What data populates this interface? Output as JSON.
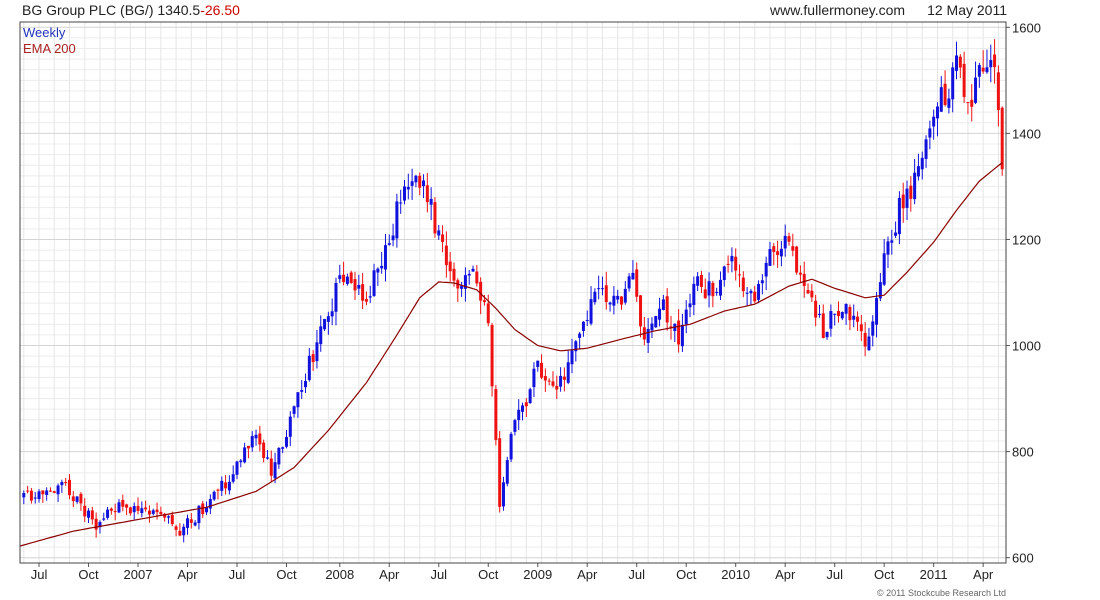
{
  "header": {
    "title": "BG Group PLC (BG/)",
    "last_price": "1340.5",
    "change": "-26.50",
    "site": "www.fullermoney.com",
    "date": "12 May 2011"
  },
  "footer": {
    "copyright": "© 2011 Stockcube Research Ltd"
  },
  "colors": {
    "up": "#1111dd",
    "down": "#ee1111",
    "ema": "#8b0000",
    "grid": "#d4d4d4"
  },
  "chart_data": {
    "type": "candlestick",
    "legend": [
      {
        "label": "Weekly",
        "color": "#2233bb"
      },
      {
        "label": "EMA 200",
        "color": "#aa2222"
      }
    ],
    "y_axis": {
      "side": "right",
      "range": [
        590,
        1610
      ],
      "ticks": [
        600,
        800,
        1000,
        1200,
        1400,
        1600
      ]
    },
    "x_axis": {
      "range": [
        "2006-05-29",
        "2011-05-16"
      ],
      "ticks": [
        {
          "label": "Jul",
          "date": "2006-07-03"
        },
        {
          "label": "Oct",
          "date": "2006-10-02"
        },
        {
          "label": "2007",
          "date": "2007-01-01"
        },
        {
          "label": "Apr",
          "date": "2007-04-02"
        },
        {
          "label": "Jul",
          "date": "2007-07-02"
        },
        {
          "label": "Oct",
          "date": "2007-10-01"
        },
        {
          "label": "2008",
          "date": "2008-01-07"
        },
        {
          "label": "Apr",
          "date": "2008-04-07"
        },
        {
          "label": "Jul",
          "date": "2008-07-07"
        },
        {
          "label": "Oct",
          "date": "2008-10-06"
        },
        {
          "label": "2009",
          "date": "2009-01-05"
        },
        {
          "label": "Apr",
          "date": "2009-04-06"
        },
        {
          "label": "Jul",
          "date": "2009-07-06"
        },
        {
          "label": "Oct",
          "date": "2009-10-05"
        },
        {
          "label": "2010",
          "date": "2010-01-04"
        },
        {
          "label": "Apr",
          "date": "2010-04-05"
        },
        {
          "label": "Jul",
          "date": "2010-07-05"
        },
        {
          "label": "Oct",
          "date": "2010-10-04"
        },
        {
          "label": "2011",
          "date": "2011-01-03"
        },
        {
          "label": "Apr",
          "date": "2011-04-04"
        }
      ]
    },
    "close_anchors": [
      [
        "2006-06-05",
        715
      ],
      [
        "2006-07-10",
        715
      ],
      [
        "2006-08-21",
        735
      ],
      [
        "2006-10-16",
        660
      ],
      [
        "2006-11-27",
        705
      ],
      [
        "2007-01-01",
        690
      ],
      [
        "2007-02-19",
        680
      ],
      [
        "2007-03-19",
        650
      ],
      [
        "2007-05-07",
        700
      ],
      [
        "2007-06-18",
        750
      ],
      [
        "2007-08-06",
        830
      ],
      [
        "2007-09-03",
        760
      ],
      [
        "2007-10-22",
        900
      ],
      [
        "2007-12-10",
        1050
      ],
      [
        "2008-01-21",
        1150
      ],
      [
        "2008-02-18",
        1080
      ],
      [
        "2008-03-24",
        1150
      ],
      [
        "2008-05-05",
        1300
      ],
      [
        "2008-06-09",
        1320
      ],
      [
        "2008-07-07",
        1200
      ],
      [
        "2008-08-04",
        1110
      ],
      [
        "2008-09-08",
        1150
      ],
      [
        "2008-10-06",
        1050
      ],
      [
        "2008-10-27",
        700
      ],
      [
        "2008-11-17",
        840
      ],
      [
        "2008-12-08",
        880
      ],
      [
        "2009-01-05",
        960
      ],
      [
        "2009-02-09",
        920
      ],
      [
        "2009-03-16",
        1000
      ],
      [
        "2009-04-20",
        1100
      ],
      [
        "2009-05-25",
        1080
      ],
      [
        "2009-06-29",
        1120
      ],
      [
        "2009-07-20",
        1000
      ],
      [
        "2009-08-24",
        1080
      ],
      [
        "2009-09-21",
        1010
      ],
      [
        "2009-10-19",
        1120
      ],
      [
        "2009-11-23",
        1100
      ],
      [
        "2009-12-28",
        1150
      ],
      [
        "2010-02-08",
        1080
      ],
      [
        "2010-03-08",
        1170
      ],
      [
        "2010-04-12",
        1190
      ],
      [
        "2010-05-17",
        1090
      ],
      [
        "2010-06-14",
        1030
      ],
      [
        "2010-07-26",
        1080
      ],
      [
        "2010-08-30",
        1000
      ],
      [
        "2010-10-04",
        1160
      ],
      [
        "2010-11-08",
        1280
      ],
      [
        "2010-12-06",
        1320
      ],
      [
        "2011-01-10",
        1450
      ],
      [
        "2011-02-14",
        1520
      ],
      [
        "2011-03-14",
        1470
      ],
      [
        "2011-04-11",
        1540
      ],
      [
        "2011-04-25",
        1500
      ],
      [
        "2011-05-09",
        1340.5
      ]
    ],
    "ema_200": [
      [
        "2006-05-29",
        622
      ],
      [
        "2006-09-04",
        650
      ],
      [
        "2007-01-01",
        672
      ],
      [
        "2007-05-07",
        695
      ],
      [
        "2007-08-06",
        725
      ],
      [
        "2007-10-15",
        770
      ],
      [
        "2007-12-17",
        840
      ],
      [
        "2008-02-25",
        930
      ],
      [
        "2008-04-21",
        1020
      ],
      [
        "2008-06-02",
        1090
      ],
      [
        "2008-07-07",
        1120
      ],
      [
        "2008-08-04",
        1118
      ],
      [
        "2008-09-15",
        1105
      ],
      [
        "2008-10-20",
        1070
      ],
      [
        "2008-11-24",
        1030
      ],
      [
        "2009-01-05",
        1000
      ],
      [
        "2009-02-16",
        990
      ],
      [
        "2009-04-06",
        995
      ],
      [
        "2009-06-08",
        1012
      ],
      [
        "2009-08-10",
        1028
      ],
      [
        "2009-10-12",
        1040
      ],
      [
        "2009-12-14",
        1065
      ],
      [
        "2010-02-08",
        1078
      ],
      [
        "2010-04-12",
        1112
      ],
      [
        "2010-05-24",
        1125
      ],
      [
        "2010-07-05",
        1108
      ],
      [
        "2010-08-30",
        1090
      ],
      [
        "2010-10-04",
        1095
      ],
      [
        "2010-11-15",
        1138
      ],
      [
        "2011-01-03",
        1195
      ],
      [
        "2011-02-14",
        1255
      ],
      [
        "2011-03-28",
        1310
      ],
      [
        "2011-05-09",
        1345
      ]
    ]
  }
}
